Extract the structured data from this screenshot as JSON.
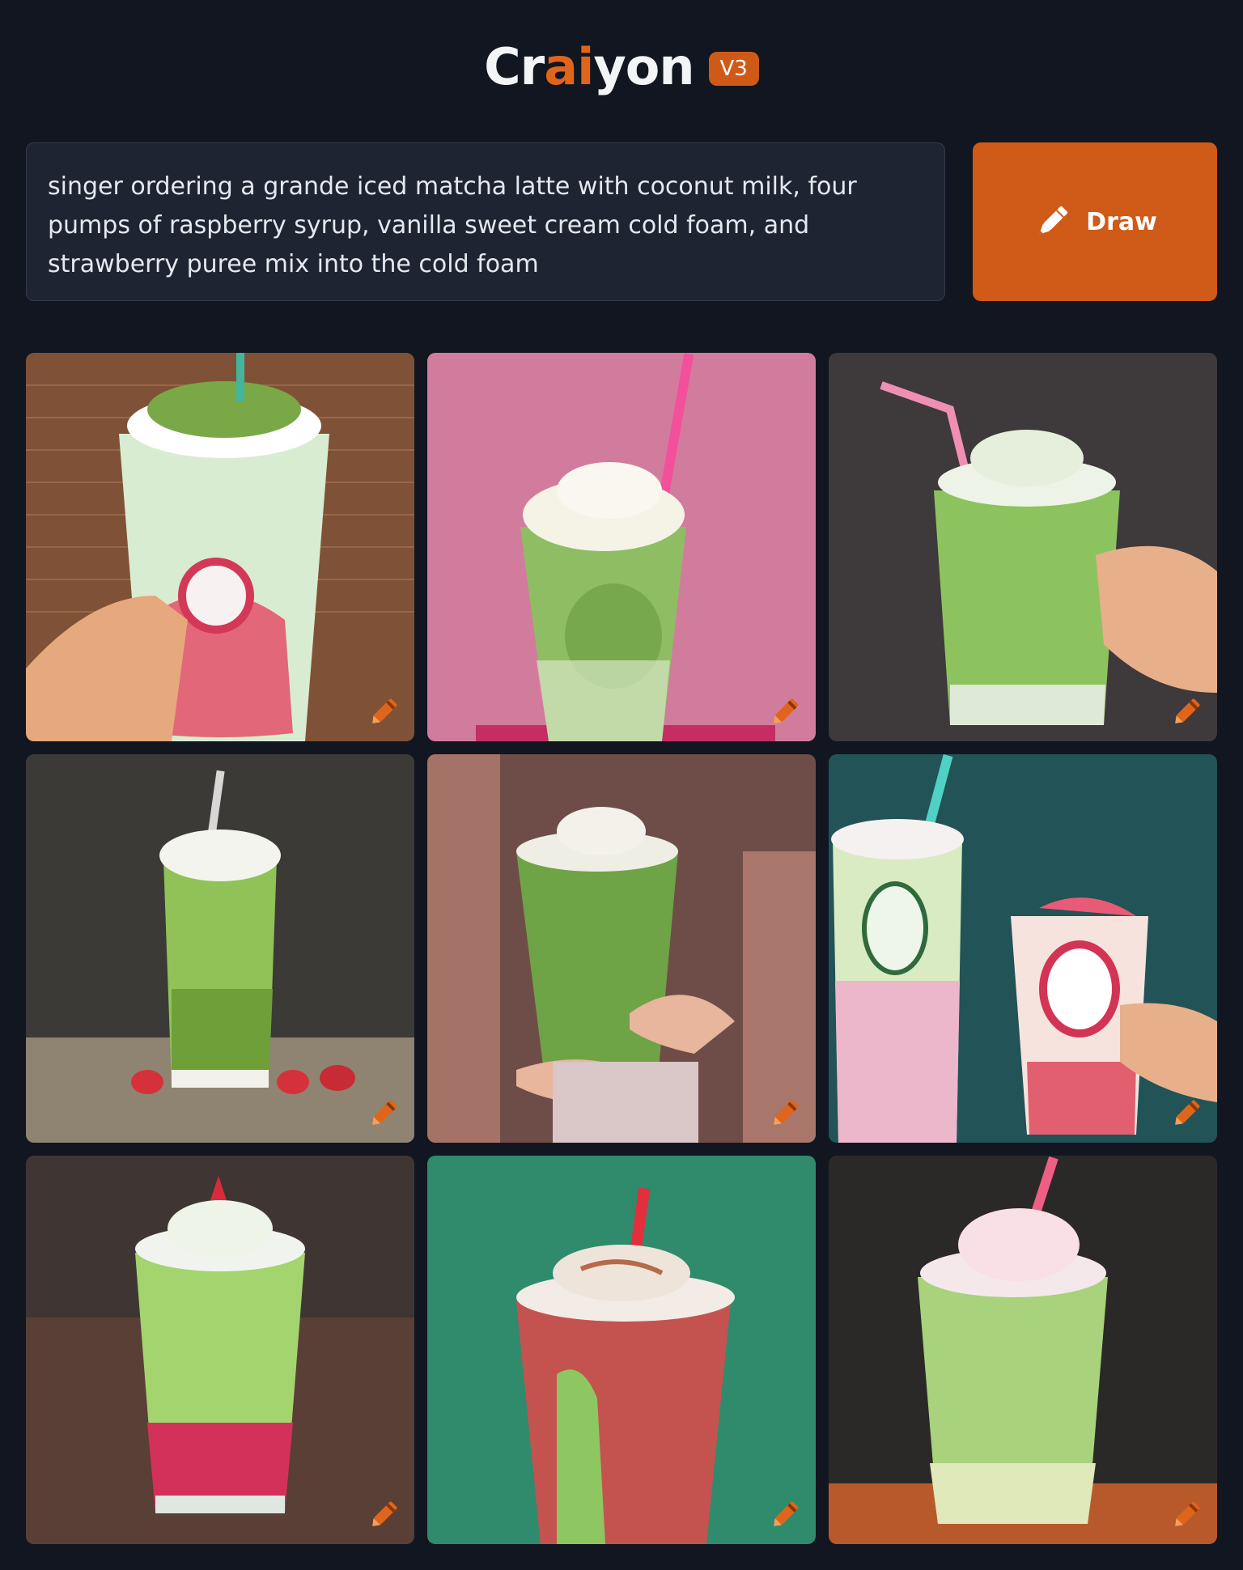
{
  "header": {
    "logo_prefix": "Cr",
    "logo_accent": "ai",
    "logo_suffix": "yon",
    "version_badge": "V3"
  },
  "prompt": {
    "text": "singer ordering a grande iced matcha latte with coconut milk, four pumps of raspberry syrup, vanilla sweet cream cold foam, and strawberry puree mix into the cold foam"
  },
  "draw_button": {
    "label": "Draw",
    "icon": "pencil-icon"
  },
  "gallery": {
    "images": [
      {
        "alt": "matcha drink with green cream and red swirl held in hand, brick wall background",
        "bg": "#8a5a3c",
        "drink": "#cfe6c2",
        "accent": "#d8364f",
        "action_icon": "crayon-icon"
      },
      {
        "alt": "green matcha latte with whipped cream and pink straw on pink background",
        "bg": "#d37a9a",
        "drink": "#8dbb62",
        "accent": "#f0f0e6",
        "action_icon": "crayon-icon"
      },
      {
        "alt": "iced matcha latte with pink straw held by hand on dark background",
        "bg": "#3f3a3c",
        "drink": "#8fc263",
        "accent": "#f2a5c4",
        "action_icon": "crayon-icon"
      },
      {
        "alt": "tall matcha drink with whipped cream and striped straw with strawberries",
        "bg": "#3d3b38",
        "drink": "#8cbf56",
        "accent": "#d7343c",
        "action_icon": "crayon-icon"
      },
      {
        "alt": "person holding iced matcha latte with whipped cream",
        "bg": "#6b4b44",
        "drink": "#6ea348",
        "accent": "#f1ede4",
        "action_icon": "crayon-icon"
      },
      {
        "alt": "two drinks, green and pink, with red swirl on teal background",
        "bg": "#23585b",
        "drink": "#d9ecc2",
        "accent": "#d93858",
        "action_icon": "crayon-icon"
      },
      {
        "alt": "matcha drink with pink bottom and whipped cream on wooden table",
        "bg": "#4a3f3e",
        "drink": "#9ad36b",
        "accent": "#d3304f",
        "action_icon": "crayon-icon"
      },
      {
        "alt": "layered red and green drink with whipped cream on green background",
        "bg": "#2f8a6a",
        "drink": "#c2504e",
        "accent": "#8fc263",
        "action_icon": "crayon-icon"
      },
      {
        "alt": "light green matcha drink with pink cream and straw on dark background",
        "bg": "#2c2a2a",
        "drink": "#a9d27c",
        "accent": "#f3c7d3",
        "action_icon": "crayon-icon"
      }
    ]
  }
}
